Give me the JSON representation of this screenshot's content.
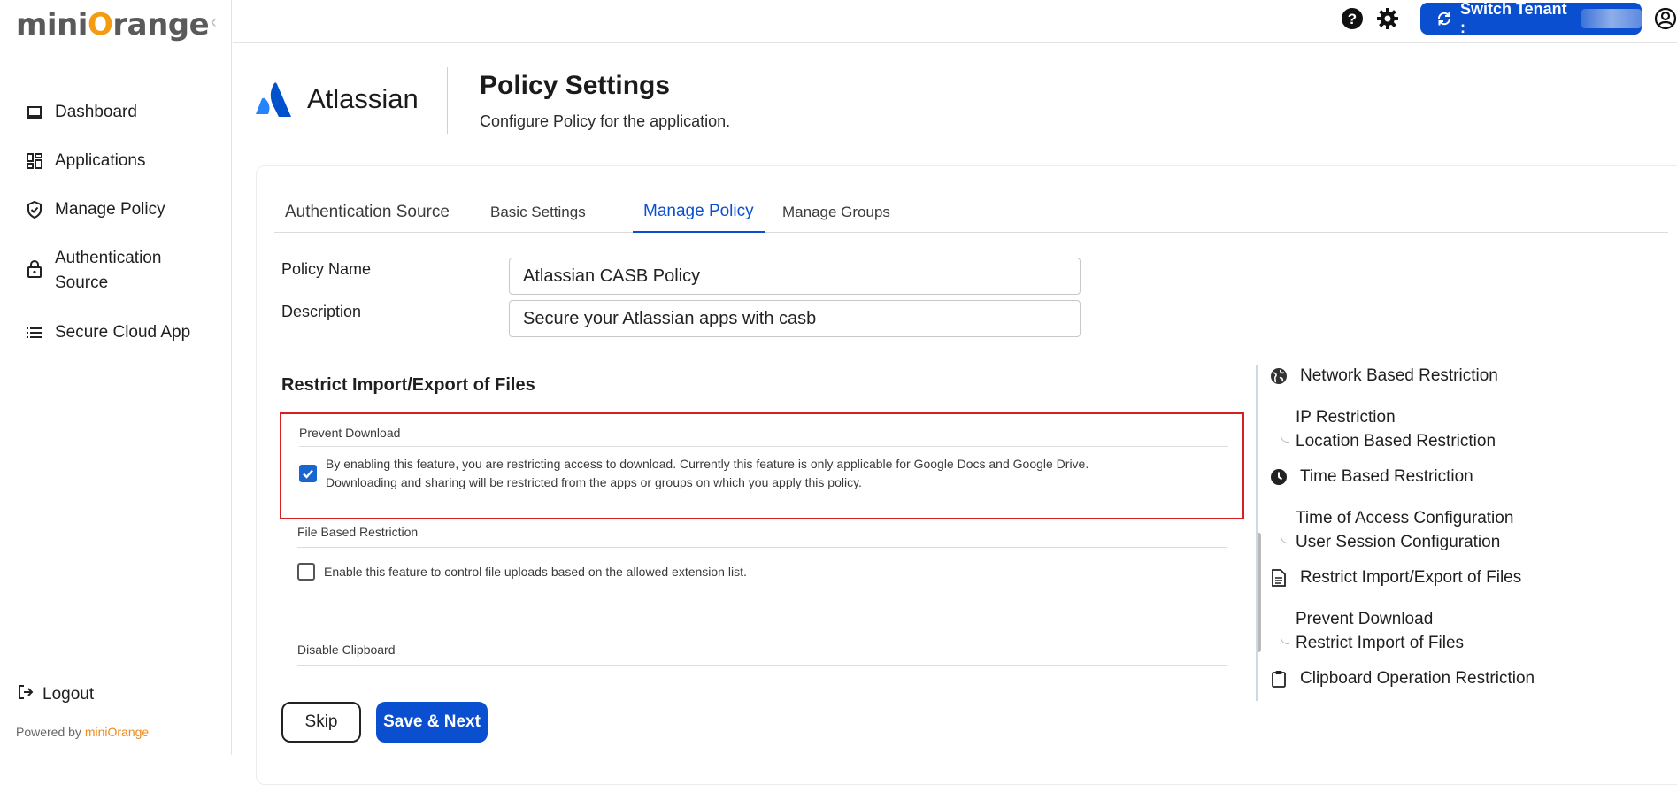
{
  "sidebar": {
    "logo": "miniOrange",
    "items": [
      {
        "label": "Dashboard",
        "icon": "laptop-icon"
      },
      {
        "label": "Applications",
        "icon": "grid-icon"
      },
      {
        "label": "Manage Policy",
        "icon": "shield-icon"
      },
      {
        "label": "Authentication Source",
        "icon": "lock-icon"
      },
      {
        "label": "Secure Cloud App",
        "icon": "list-icon"
      }
    ],
    "logout_label": "Logout",
    "powered_by": "Powered by",
    "powered_brand": "miniOrange"
  },
  "topbar": {
    "switch_tenant_label": "Switch Tenant :"
  },
  "app": {
    "name": "Atlassian",
    "page_title": "Policy Settings",
    "page_subtitle": "Configure Policy for the application."
  },
  "tabs": [
    {
      "label": "Authentication Source"
    },
    {
      "label": "Basic Settings"
    },
    {
      "label": "Manage Policy",
      "active": true
    },
    {
      "label": "Manage Groups"
    }
  ],
  "form": {
    "policy_name_label": "Policy Name",
    "policy_name_value": "Atlassian CASB Policy",
    "description_label": "Description",
    "description_value": "Secure your Atlassian apps with casb"
  },
  "section": {
    "title": "Restrict Import/Export of Files",
    "features": [
      {
        "title": "Prevent Download",
        "checked": true,
        "desc_line1": "By enabling this feature, you are restricting access to download. Currently this feature is only applicable for Google Docs and Google Drive.",
        "desc_line2": "Downloading and sharing will be restricted from the apps or groups on which you apply this policy."
      },
      {
        "title": "File Based Restriction",
        "checked": false,
        "desc_line1": "Enable this feature to control file uploads based on the allowed extension list."
      },
      {
        "title": "Disable Clipboard"
      }
    ]
  },
  "buttons": {
    "skip": "Skip",
    "save_next": "Save & Next"
  },
  "toc": {
    "network": "Network Based Restriction",
    "ip": "IP Restriction",
    "location": "Location Based Restriction",
    "time": "Time Based Restriction",
    "time_access": "Time of Access Configuration",
    "user_session": "User Session Configuration",
    "restrict_files": "Restrict Import/Export of Files",
    "prevent_download": "Prevent Download",
    "restrict_import": "Restrict Import of Files",
    "clipboard": "Clipboard Operation Restriction"
  },
  "colors": {
    "accent": "#0b4fd1",
    "brand_orange": "#f39c12",
    "highlight_border": "#d61f1f"
  }
}
